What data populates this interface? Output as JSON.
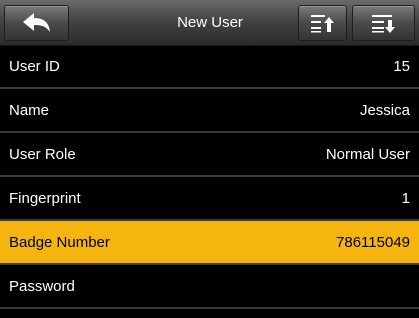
{
  "header": {
    "title": "New User",
    "back_icon": "back-arrow-icon",
    "page_up_icon": "list-page-up-icon",
    "page_down_icon": "list-page-down-icon"
  },
  "fields": [
    {
      "label": "User ID",
      "value": "15"
    },
    {
      "label": "Name",
      "value": "Jessica"
    },
    {
      "label": "User Role",
      "value": "Normal User"
    },
    {
      "label": "Fingerprint",
      "value": "1"
    },
    {
      "label": "Badge Number",
      "value": "786115049"
    },
    {
      "label": "Password",
      "value": ""
    }
  ],
  "colors": {
    "selected_row": "#f5b50e",
    "background": "#000000",
    "text": "#ffffff"
  }
}
